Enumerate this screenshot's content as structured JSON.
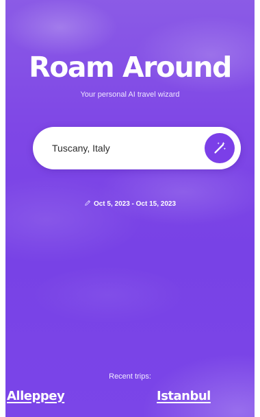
{
  "app": {
    "title": "Roam Around",
    "subtitle": "Your personal AI travel wizard"
  },
  "search": {
    "value": "Tuscany, Italy",
    "button_icon": "magic-wand-icon"
  },
  "dates": {
    "icon": "pencil-icon",
    "label": "Oct 5, 2023 - Oct 15, 2023"
  },
  "recent": {
    "label": "Recent trips:",
    "trips": [
      {
        "name": "Alleppey"
      },
      {
        "name": "Istanbul"
      }
    ]
  },
  "colors": {
    "background": "#7b45e8",
    "accent": "#7b3fe8",
    "text": "#ffffff"
  }
}
